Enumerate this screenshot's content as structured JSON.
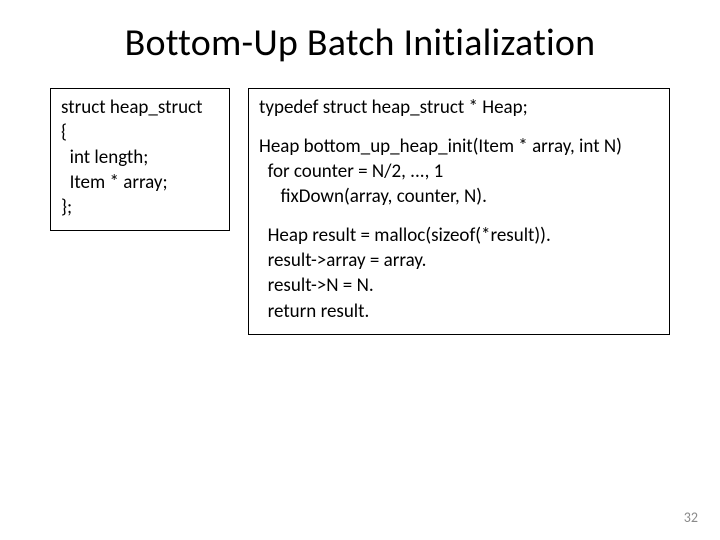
{
  "title": "Bottom-Up Batch Initialization",
  "left_code": "struct heap_struct\n{\n  int length;\n  Item * array;\n};",
  "right_typedef": "typedef struct heap_struct * Heap;",
  "right_func": "Heap bottom_up_heap_init(Item * array, int N)\n  for counter = N/2, ..., 1\n     fixDown(array, counter, N).",
  "right_ret": "  Heap result = malloc(sizeof(*result)).\n  result->array = array.\n  result->N = N.\n  return result.",
  "page_number": "32"
}
